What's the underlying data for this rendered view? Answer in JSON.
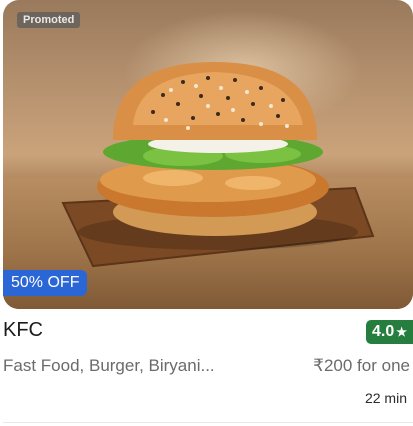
{
  "restaurant": {
    "image_icon": "burger-image",
    "promoted_label": "Promoted",
    "offer_label": "50% OFF",
    "name": "KFC",
    "rating": "4.0",
    "rating_icon": "star-icon",
    "cuisines": "Fast Food, Burger, Biryani...",
    "price": "₹200 for one",
    "delivery_time": "22 min"
  },
  "colors": {
    "offer_bg": "#2a66d6",
    "rating_bg": "#267e3e",
    "promoted_bg": "#5a5a5a"
  }
}
